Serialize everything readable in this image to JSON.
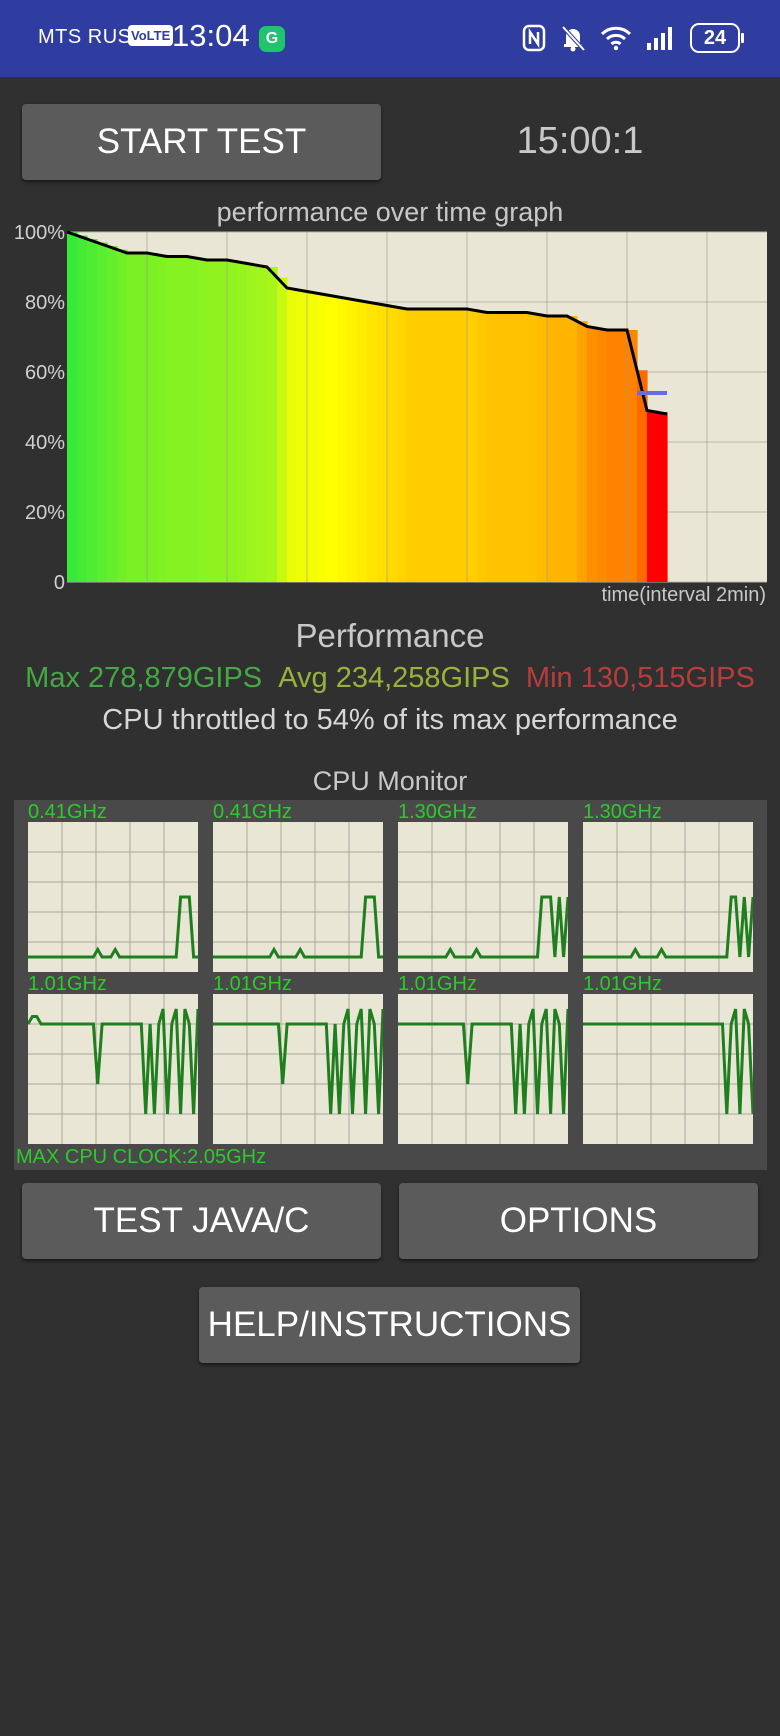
{
  "status_bar": {
    "carrier": "MTS RUS",
    "volte": "VoLTE",
    "time": "13:04",
    "app_icon": "G",
    "battery": "24",
    "icons": [
      "nfc-icon",
      "bell-muted-icon",
      "wifi-icon",
      "signal-icon",
      "battery-icon"
    ]
  },
  "controls": {
    "start_label": "START TEST",
    "timer": "15:00:1",
    "java_label": "TEST JAVA/C",
    "options_label": "OPTIONS",
    "help_label": "HELP/INSTRUCTIONS"
  },
  "chart_data": {
    "type": "area",
    "title": "performance over time graph",
    "xlabel": "time(interval 2min)",
    "y_ticks": [
      "100%",
      "80%",
      "60%",
      "40%",
      "20%",
      "0"
    ],
    "ylim": [
      0,
      100
    ],
    "x_minutes": [
      0,
      1,
      2,
      3,
      4,
      5,
      6,
      7,
      8,
      9,
      10,
      11,
      12,
      13,
      14,
      15,
      16,
      17,
      18,
      19,
      20,
      21,
      22,
      23,
      24,
      25,
      26,
      27,
      28,
      29,
      30
    ],
    "values": [
      100,
      98,
      96,
      94,
      94,
      93,
      93,
      92,
      92,
      91,
      90,
      84,
      83,
      82,
      81,
      80,
      79,
      78,
      78,
      78,
      78,
      77,
      77,
      77,
      76,
      76,
      73,
      72,
      72,
      49,
      48
    ],
    "min_marker_percent": 54,
    "grid": true,
    "gradient_colors": [
      "#38ea38",
      "#ffff00",
      "#ff6a00",
      "#ff0000"
    ]
  },
  "performance": {
    "title": "Performance",
    "max": "Max 278,879GIPS",
    "avg": "Avg 234,258GIPS",
    "min": "Min 130,515GIPS",
    "throttle": "CPU throttled to 54% of its max performance"
  },
  "cpu_monitor": {
    "title": "CPU Monitor",
    "max_clock": "MAX CPU CLOCK:2.05GHz",
    "cores": [
      {
        "freq": "0.41GHz",
        "load": [
          0.1,
          0.1,
          0.1,
          0.1,
          0.1,
          0.1,
          0.1,
          0.1,
          0.1,
          0.1,
          0.1,
          0.1,
          0.1,
          0.1,
          0.1,
          0.1,
          0.15,
          0.1,
          0.1,
          0.1,
          0.15,
          0.1,
          0.1,
          0.1,
          0.1,
          0.1,
          0.1,
          0.1,
          0.1,
          0.1,
          0.1,
          0.1,
          0.1,
          0.1,
          0.1,
          0.5,
          0.5,
          0.5,
          0.1,
          0.1
        ]
      },
      {
        "freq": "0.41GHz",
        "load": [
          0.1,
          0.1,
          0.1,
          0.1,
          0.1,
          0.1,
          0.1,
          0.1,
          0.1,
          0.1,
          0.1,
          0.1,
          0.1,
          0.1,
          0.15,
          0.1,
          0.1,
          0.1,
          0.1,
          0.1,
          0.15,
          0.1,
          0.1,
          0.1,
          0.1,
          0.1,
          0.1,
          0.1,
          0.1,
          0.1,
          0.1,
          0.1,
          0.1,
          0.1,
          0.1,
          0.5,
          0.5,
          0.5,
          0.1,
          0.1
        ]
      },
      {
        "freq": "1.30GHz",
        "load": [
          0.1,
          0.1,
          0.1,
          0.1,
          0.1,
          0.1,
          0.1,
          0.1,
          0.1,
          0.1,
          0.1,
          0.1,
          0.15,
          0.1,
          0.1,
          0.1,
          0.1,
          0.1,
          0.15,
          0.1,
          0.1,
          0.1,
          0.1,
          0.1,
          0.1,
          0.1,
          0.1,
          0.1,
          0.1,
          0.1,
          0.1,
          0.1,
          0.1,
          0.5,
          0.5,
          0.5,
          0.1,
          0.5,
          0.1,
          0.5
        ]
      },
      {
        "freq": "1.30GHz",
        "load": [
          0.1,
          0.1,
          0.1,
          0.1,
          0.1,
          0.1,
          0.1,
          0.1,
          0.1,
          0.1,
          0.1,
          0.1,
          0.15,
          0.1,
          0.1,
          0.1,
          0.1,
          0.1,
          0.15,
          0.1,
          0.1,
          0.1,
          0.1,
          0.1,
          0.1,
          0.1,
          0.1,
          0.1,
          0.1,
          0.1,
          0.1,
          0.1,
          0.1,
          0.1,
          0.5,
          0.5,
          0.1,
          0.5,
          0.1,
          0.5
        ]
      },
      {
        "freq": "1.01GHz",
        "load": [
          0.8,
          0.85,
          0.85,
          0.8,
          0.8,
          0.8,
          0.8,
          0.8,
          0.8,
          0.8,
          0.8,
          0.8,
          0.8,
          0.8,
          0.8,
          0.8,
          0.4,
          0.8,
          0.8,
          0.8,
          0.8,
          0.8,
          0.8,
          0.8,
          0.8,
          0.8,
          0.8,
          0.2,
          0.8,
          0.2,
          0.8,
          0.9,
          0.2,
          0.8,
          0.9,
          0.2,
          0.9,
          0.8,
          0.2,
          0.9
        ]
      },
      {
        "freq": "1.01GHz",
        "load": [
          0.8,
          0.8,
          0.8,
          0.8,
          0.8,
          0.8,
          0.8,
          0.8,
          0.8,
          0.8,
          0.8,
          0.8,
          0.8,
          0.8,
          0.8,
          0.8,
          0.4,
          0.8,
          0.8,
          0.8,
          0.8,
          0.8,
          0.8,
          0.8,
          0.8,
          0.8,
          0.8,
          0.2,
          0.8,
          0.2,
          0.8,
          0.9,
          0.2,
          0.8,
          0.9,
          0.2,
          0.9,
          0.8,
          0.2,
          0.9
        ]
      },
      {
        "freq": "1.01GHz",
        "load": [
          0.8,
          0.8,
          0.8,
          0.8,
          0.8,
          0.8,
          0.8,
          0.8,
          0.8,
          0.8,
          0.8,
          0.8,
          0.8,
          0.8,
          0.8,
          0.8,
          0.4,
          0.8,
          0.8,
          0.8,
          0.8,
          0.8,
          0.8,
          0.8,
          0.8,
          0.8,
          0.8,
          0.2,
          0.8,
          0.2,
          0.8,
          0.9,
          0.2,
          0.8,
          0.9,
          0.2,
          0.9,
          0.8,
          0.2,
          0.9
        ]
      },
      {
        "freq": "1.01GHz",
        "load": [
          0.8,
          0.8,
          0.8,
          0.8,
          0.8,
          0.8,
          0.8,
          0.8,
          0.8,
          0.8,
          0.8,
          0.8,
          0.8,
          0.8,
          0.8,
          0.8,
          0.8,
          0.8,
          0.8,
          0.8,
          0.8,
          0.8,
          0.8,
          0.8,
          0.8,
          0.8,
          0.8,
          0.8,
          0.8,
          0.8,
          0.8,
          0.8,
          0.8,
          0.2,
          0.8,
          0.9,
          0.2,
          0.9,
          0.8,
          0.2
        ]
      }
    ]
  }
}
